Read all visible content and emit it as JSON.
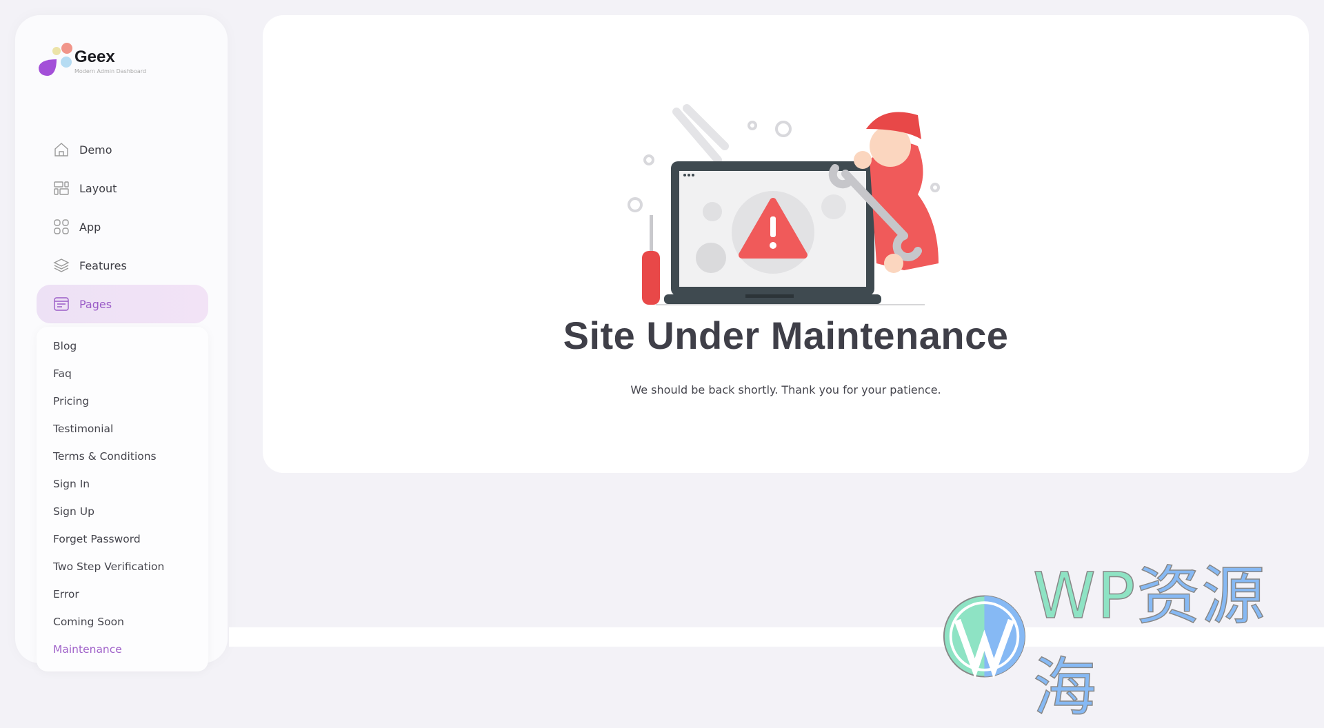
{
  "brand": {
    "name": "Geex",
    "tagline": "Modern Admin Dashboard"
  },
  "sidebar": {
    "items": [
      {
        "label": "Demo",
        "icon": "home-icon"
      },
      {
        "label": "Layout",
        "icon": "layout-icon"
      },
      {
        "label": "App",
        "icon": "grid-icon"
      },
      {
        "label": "Features",
        "icon": "layers-icon"
      },
      {
        "label": "Pages",
        "icon": "browser-icon",
        "active": true
      }
    ],
    "submenu": [
      "Blog",
      "Faq",
      "Pricing",
      "Testimonial",
      "Terms & Conditions",
      "Sign In",
      "Sign Up",
      "Forget Password",
      "Two Step Verification",
      "Error",
      "Coming Soon",
      "Maintenance"
    ],
    "active_submenu": "Maintenance"
  },
  "main": {
    "title": "Site Under Maintenance",
    "subtitle": "We should be back shortly. Thank you for your patience."
  },
  "watermark": {
    "text_latin": "WP",
    "text_cn": "资源海"
  },
  "colors": {
    "accent": "#9a5cc7",
    "illustration_red": "#f05a5a",
    "laptop": "#3f4a50"
  }
}
